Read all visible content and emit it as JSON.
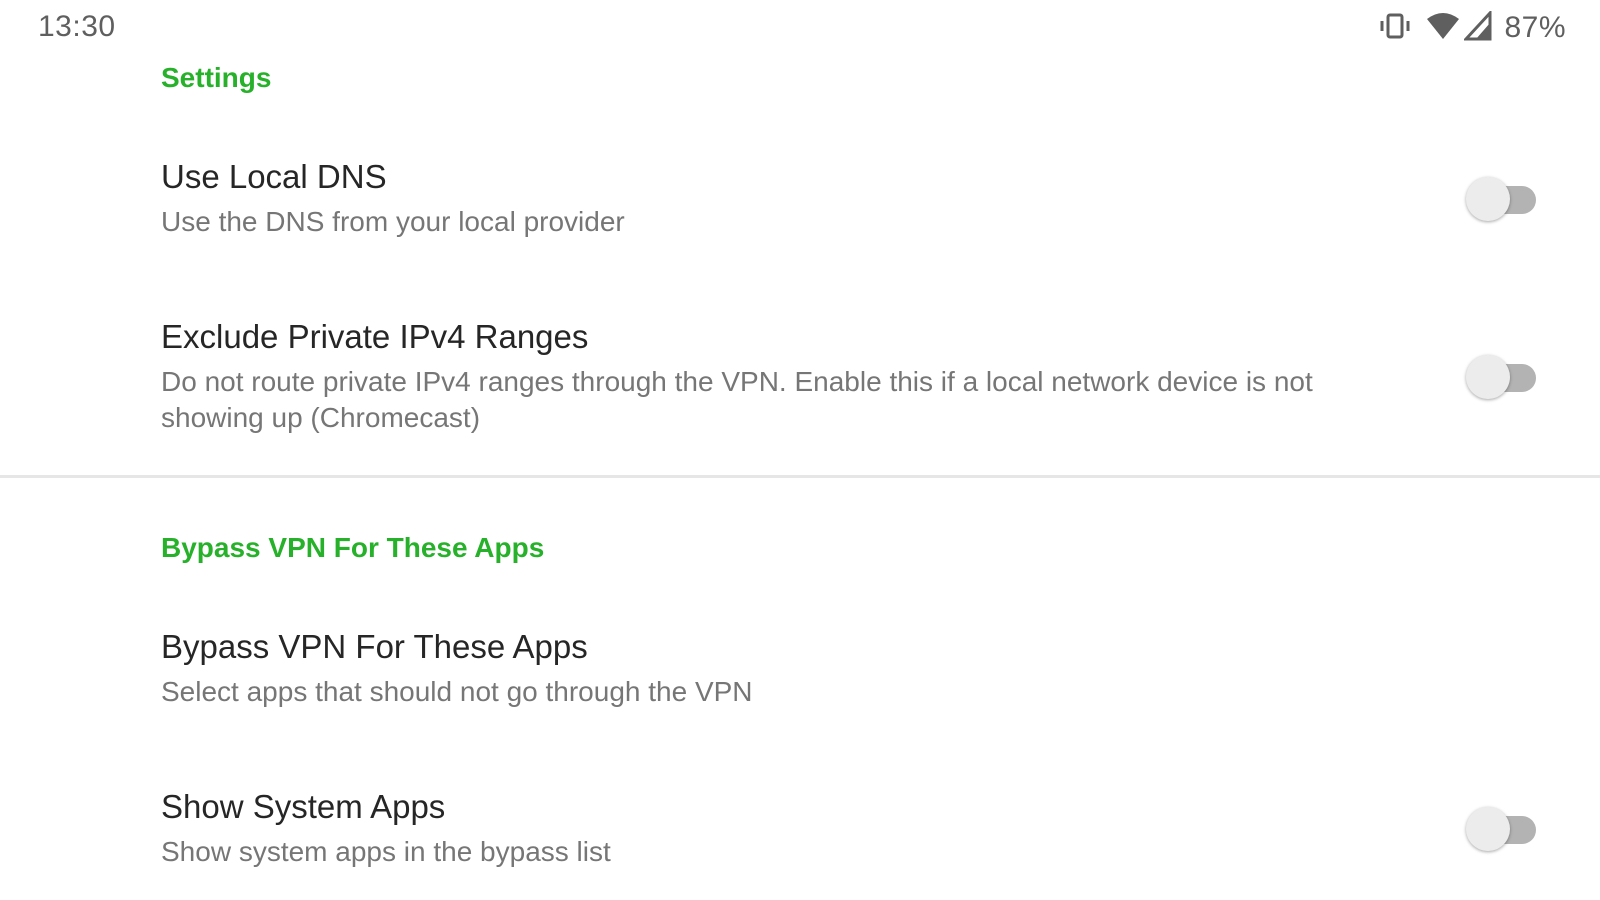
{
  "status_bar": {
    "time": "13:30",
    "icons": [
      "vibrate-icon",
      "wifi-icon",
      "signal-icon"
    ],
    "battery": "87%"
  },
  "settings": {
    "category_title": "Settings",
    "use_local_dns": {
      "title": "Use Local DNS",
      "summary": "Use the DNS from your local provider",
      "enabled": false
    },
    "exclude_private": {
      "title": "Exclude Private IPv4 Ranges",
      "summary": "Do not route private IPv4 ranges through the VPN. Enable this if a local network device is not showing up (Chromecast)",
      "enabled": false
    }
  },
  "bypass": {
    "category_title": "Bypass VPN For These Apps",
    "bypass_apps": {
      "title": "Bypass VPN For These Apps",
      "summary": "Select apps that should not go through the VPN"
    },
    "show_system_apps": {
      "title": "Show System Apps",
      "summary": "Show system apps in the bypass list",
      "enabled": false
    }
  },
  "colors": {
    "accent": "#27b12a",
    "title_text": "#262626",
    "summary_text": "#767676",
    "switch_track_off": "#b3b3b3",
    "switch_thumb_off": "#ececec"
  }
}
